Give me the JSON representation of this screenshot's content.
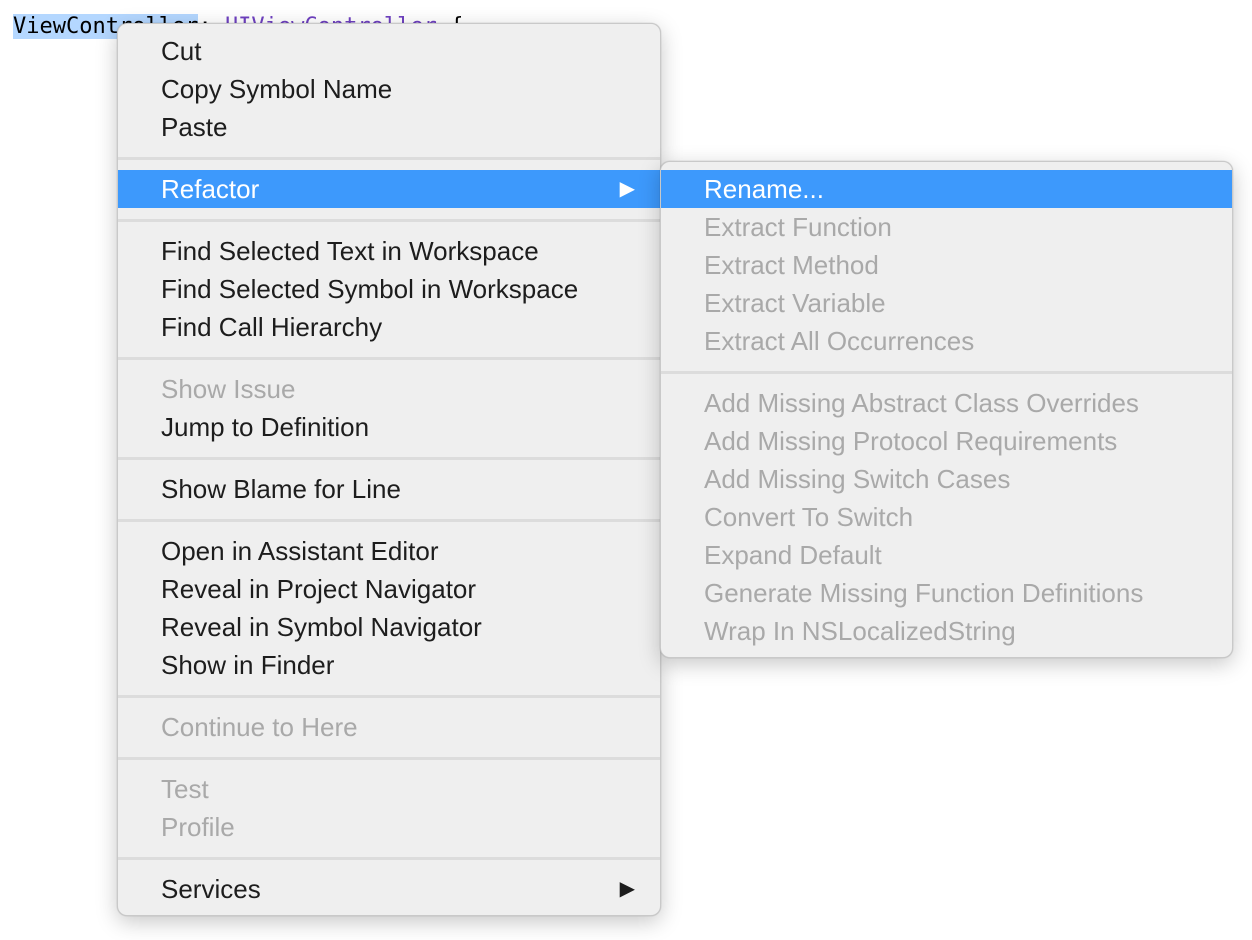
{
  "editor": {
    "selected_token": "ViewController",
    "colon": ":",
    "superclass": "UIViewController",
    "brace": "{"
  },
  "context_menu": {
    "groups": [
      [
        {
          "label": "Cut",
          "enabled": true
        },
        {
          "label": "Copy Symbol Name",
          "enabled": true
        },
        {
          "label": "Paste",
          "enabled": true
        }
      ],
      [
        {
          "label": "Refactor",
          "enabled": true,
          "highlighted": true,
          "submenu_arrow": "▶"
        }
      ],
      [
        {
          "label": "Find Selected Text in Workspace",
          "enabled": true
        },
        {
          "label": "Find Selected Symbol in Workspace",
          "enabled": true
        },
        {
          "label": "Find Call Hierarchy",
          "enabled": true
        }
      ],
      [
        {
          "label": "Show Issue",
          "enabled": false
        },
        {
          "label": "Jump to Definition",
          "enabled": true
        }
      ],
      [
        {
          "label": "Show Blame for Line",
          "enabled": true
        }
      ],
      [
        {
          "label": "Open in Assistant Editor",
          "enabled": true
        },
        {
          "label": "Reveal in Project Navigator",
          "enabled": true
        },
        {
          "label": "Reveal in Symbol Navigator",
          "enabled": true
        },
        {
          "label": "Show in Finder",
          "enabled": true
        }
      ],
      [
        {
          "label": "Continue to Here",
          "enabled": false
        }
      ],
      [
        {
          "label": "Test",
          "enabled": false
        },
        {
          "label": "Profile",
          "enabled": false
        }
      ],
      [
        {
          "label": "Services",
          "enabled": true,
          "submenu_arrow": "▶"
        }
      ]
    ]
  },
  "refactor_submenu": {
    "groups": [
      [
        {
          "label": "Rename...",
          "enabled": true,
          "highlighted": true
        },
        {
          "label": "Extract Function",
          "enabled": false
        },
        {
          "label": "Extract Method",
          "enabled": false
        },
        {
          "label": "Extract Variable",
          "enabled": false
        },
        {
          "label": "Extract All Occurrences",
          "enabled": false
        }
      ],
      [
        {
          "label": "Add Missing Abstract Class Overrides",
          "enabled": false
        },
        {
          "label": "Add Missing Protocol Requirements",
          "enabled": false
        },
        {
          "label": "Add Missing Switch Cases",
          "enabled": false
        },
        {
          "label": "Convert To Switch",
          "enabled": false
        },
        {
          "label": "Expand Default",
          "enabled": false
        },
        {
          "label": "Generate Missing Function Definitions",
          "enabled": false
        },
        {
          "label": "Wrap In NSLocalizedString",
          "enabled": false
        }
      ]
    ]
  },
  "colors": {
    "highlight": "#3d99fc",
    "disabled_text": "#a9a9a9",
    "menu_background": "#efefef",
    "code_selection": "#b4d7ff"
  }
}
